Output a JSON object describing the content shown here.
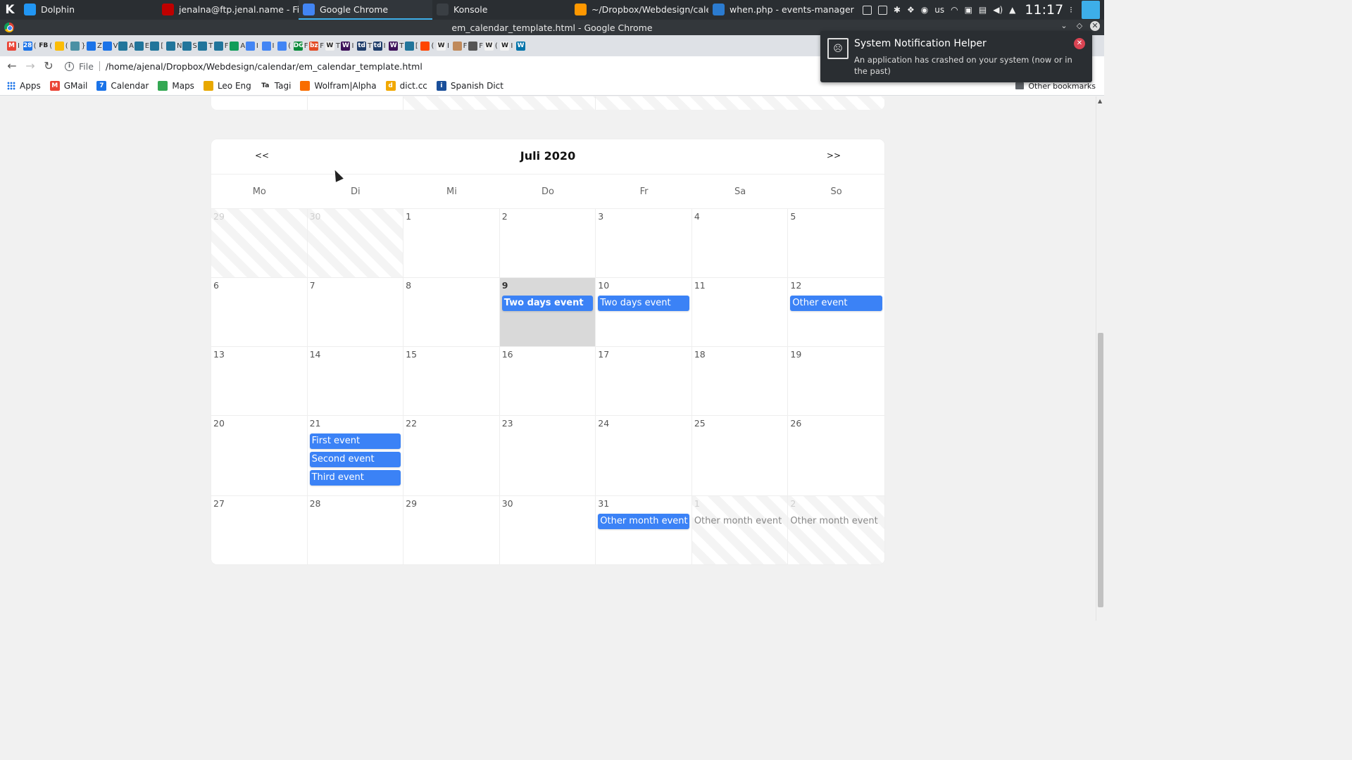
{
  "panel": {
    "tasks": [
      {
        "label": "Dolphin",
        "icon": "dolphin-icon",
        "color": "#2196f3"
      },
      {
        "label": "jenalna@ftp.jenal.name - File...",
        "icon": "filezilla-icon",
        "color": "#bf0000"
      },
      {
        "label": "Google Chrome",
        "icon": "chrome-icon",
        "color": "#4285f4",
        "active": true
      },
      {
        "label": "Konsole",
        "icon": "konsole-icon",
        "color": "#3a3f44"
      },
      {
        "label": "~/Dropbox/Webdesign/calen...",
        "icon": "sublime-icon",
        "color": "#ff9800"
      },
      {
        "label": "when.php - events-manager ...",
        "icon": "vscode-icon",
        "color": "#2b7bd0"
      }
    ],
    "keyboard_layout": "us",
    "clock": "11:17"
  },
  "window": {
    "title": "em_calendar_template.html - Google Chrome"
  },
  "tabs": [
    {
      "icon": "gmail-icon",
      "color": "#ea4335",
      "glyph": "M",
      "trunc": "I"
    },
    {
      "icon": "calendar-icon",
      "color": "#1a73e8",
      "glyph": "28",
      "trunc": "("
    },
    {
      "icon": "fb-icon",
      "color": "#dee1e6",
      "glyph": "FB",
      "trunc": "("
    },
    {
      "icon": "keep-icon",
      "color": "#fbbc04",
      "glyph": "",
      "trunc": "("
    },
    {
      "icon": "bird-icon",
      "color": "#4a90a4",
      "glyph": "",
      "trunc": "}"
    },
    {
      "icon": "drawing-icon",
      "color": "#1a73e8",
      "glyph": "",
      "trunc": "Z"
    },
    {
      "icon": "drawing-icon",
      "color": "#1a73e8",
      "glyph": "",
      "trunc": "V"
    },
    {
      "icon": "wp-icon",
      "color": "#21759b",
      "glyph": "",
      "trunc": "A"
    },
    {
      "icon": "wp-icon",
      "color": "#21759b",
      "glyph": "",
      "trunc": "E"
    },
    {
      "icon": "wp-icon",
      "color": "#21759b",
      "glyph": "",
      "trunc": "["
    },
    {
      "icon": "wp-icon",
      "color": "#21759b",
      "glyph": "",
      "trunc": "N"
    },
    {
      "icon": "wp-icon",
      "color": "#21759b",
      "glyph": "",
      "trunc": "S"
    },
    {
      "icon": "wp-icon",
      "color": "#21759b",
      "glyph": "",
      "trunc": "T"
    },
    {
      "icon": "wp-icon",
      "color": "#21759b",
      "glyph": "",
      "trunc": "F"
    },
    {
      "icon": "drive-icon",
      "color": "#0f9d58",
      "glyph": "",
      "trunc": "A"
    },
    {
      "icon": "docs-icon",
      "color": "#4285f4",
      "glyph": "",
      "trunc": "I"
    },
    {
      "icon": "docs-icon",
      "color": "#4285f4",
      "glyph": "",
      "trunc": "I"
    },
    {
      "icon": "docs-icon",
      "color": "#4285f4",
      "glyph": "",
      "trunc": "("
    },
    {
      "icon": "dg-icon",
      "color": "#0a8a3a",
      "glyph": "DG",
      "trunc": "F"
    },
    {
      "icon": "dz-icon",
      "color": "#e34a25",
      "glyph": "bz",
      "trunc": "F"
    },
    {
      "icon": "wiki-icon",
      "color": "#f2f2f2",
      "glyph": "W",
      "trunc": "T"
    },
    {
      "icon": "wiki-dark-icon",
      "color": "#3d1159",
      "glyph": "W",
      "trunc": "I"
    },
    {
      "icon": "tds-icon",
      "color": "#1f3d6a",
      "glyph": "td",
      "trunc": "T"
    },
    {
      "icon": "tds-icon",
      "color": "#1f3d6a",
      "glyph": "td",
      "trunc": "I"
    },
    {
      "icon": "wiki-dark-icon",
      "color": "#3d1159",
      "glyph": "W",
      "trunc": "T"
    },
    {
      "icon": "wp-icon",
      "color": "#21759b",
      "glyph": "",
      "trunc": "["
    },
    {
      "icon": "reddit-icon",
      "color": "#ff4500",
      "glyph": "",
      "trunc": "("
    },
    {
      "icon": "wiki-icon",
      "color": "#f2f2f2",
      "glyph": "W",
      "trunc": "I"
    },
    {
      "icon": "cookie-icon",
      "color": "#c08a5b",
      "glyph": "",
      "trunc": "F"
    },
    {
      "icon": "book-icon",
      "color": "#555555",
      "glyph": "",
      "trunc": "F"
    },
    {
      "icon": "wiki-icon",
      "color": "#f2f2f2",
      "glyph": "W",
      "trunc": "("
    },
    {
      "icon": "wiki-icon",
      "color": "#f2f2f2",
      "glyph": "W",
      "trunc": "I"
    },
    {
      "icon": "wordpress-icon",
      "color": "#0073aa",
      "glyph": "W",
      "trunc": ""
    }
  ],
  "toolbar": {
    "scheme": "File",
    "url": "/home/ajenal/Dropbox/Webdesign/calendar/em_calendar_template.html"
  },
  "bookmarks": {
    "items": [
      {
        "label": "Apps",
        "icon": "apps-grid-icon",
        "color": "#1a73e8"
      },
      {
        "label": "GMail",
        "icon": "gmail-icon",
        "color": "#ea4335",
        "glyph": "M"
      },
      {
        "label": "Calendar",
        "icon": "calendar-icon",
        "color": "#1a73e8",
        "glyph": "7"
      },
      {
        "label": "Maps",
        "icon": "maps-icon",
        "color": "#34a853",
        "glyph": ""
      },
      {
        "label": "Leo Eng",
        "icon": "leo-icon",
        "color": "#e8a800",
        "glyph": ""
      },
      {
        "label": "Tagi",
        "icon": "tagi-icon",
        "color": "#ffffff",
        "glyph": "Ta"
      },
      {
        "label": "Wolfram|Alpha",
        "icon": "wolfram-icon",
        "color": "#f96d00",
        "glyph": ""
      },
      {
        "label": "dict.cc",
        "icon": "dictcc-icon",
        "color": "#f1a800",
        "glyph": "d"
      },
      {
        "label": "Spanish Dict",
        "icon": "spanishdict-icon",
        "color": "#1a4f9a",
        "glyph": "i"
      }
    ],
    "other": "Other bookmarks"
  },
  "calendar": {
    "prev_label": "<<",
    "next_label": ">>",
    "title": "Juli 2020",
    "weekdays": [
      "Mo",
      "Di",
      "Mi",
      "Do",
      "Fr",
      "Sa",
      "So"
    ],
    "weeks": [
      [
        {
          "day": "29",
          "other": true,
          "events": []
        },
        {
          "day": "30",
          "other": true,
          "events": []
        },
        {
          "day": "1",
          "events": []
        },
        {
          "day": "2",
          "events": []
        },
        {
          "day": "3",
          "events": []
        },
        {
          "day": "4",
          "events": []
        },
        {
          "day": "5",
          "events": []
        }
      ],
      [
        {
          "day": "6",
          "events": []
        },
        {
          "day": "7",
          "events": []
        },
        {
          "day": "8",
          "events": []
        },
        {
          "day": "9",
          "today": true,
          "events": [
            {
              "label": "Two days event",
              "style": "bold"
            }
          ]
        },
        {
          "day": "10",
          "events": [
            {
              "label": "Two days event",
              "style": "normal"
            }
          ]
        },
        {
          "day": "11",
          "events": []
        },
        {
          "day": "12",
          "events": [
            {
              "label": "Other event",
              "style": "normal"
            }
          ]
        }
      ],
      [
        {
          "day": "13",
          "events": []
        },
        {
          "day": "14",
          "events": []
        },
        {
          "day": "15",
          "events": []
        },
        {
          "day": "16",
          "events": []
        },
        {
          "day": "17",
          "events": []
        },
        {
          "day": "18",
          "events": []
        },
        {
          "day": "19",
          "events": []
        }
      ],
      [
        {
          "day": "20",
          "events": []
        },
        {
          "day": "21",
          "events": [
            {
              "label": "First event",
              "style": "normal"
            },
            {
              "label": "Second event",
              "style": "normal"
            },
            {
              "label": "Third event",
              "style": "normal"
            }
          ]
        },
        {
          "day": "22",
          "events": []
        },
        {
          "day": "23",
          "events": []
        },
        {
          "day": "24",
          "events": []
        },
        {
          "day": "25",
          "events": []
        },
        {
          "day": "26",
          "events": []
        }
      ],
      [
        {
          "day": "27",
          "events": []
        },
        {
          "day": "28",
          "events": []
        },
        {
          "day": "29",
          "events": []
        },
        {
          "day": "30",
          "events": []
        },
        {
          "day": "31",
          "events": [
            {
              "label": "Other month event",
              "style": "normal"
            }
          ]
        },
        {
          "day": "1",
          "other": true,
          "events": [
            {
              "label": "Other month event",
              "style": "plain"
            }
          ]
        },
        {
          "day": "2",
          "other": true,
          "events": [
            {
              "label": "Other month event",
              "style": "plain"
            }
          ]
        }
      ]
    ],
    "colors": {
      "event": "#3b82f6",
      "today": "#d9d9d9"
    }
  },
  "notification": {
    "title": "System Notification Helper",
    "body": "An application has crashed on your system (now or in the past)",
    "icon": "crash-face-icon"
  }
}
